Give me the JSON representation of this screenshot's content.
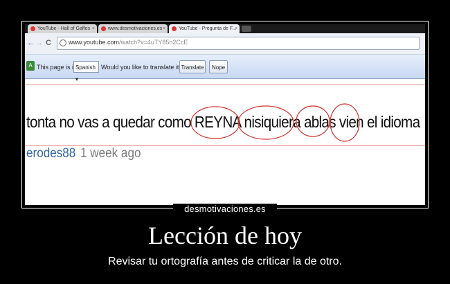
{
  "browser": {
    "tabs": [
      {
        "title": "YouTube - Hall of Gaffes",
        "active": false
      },
      {
        "title": "www.desmotivaciones.es",
        "active": false
      },
      {
        "title": "YouTube - Pregunta de F...",
        "active": true
      }
    ],
    "url_host": "www.youtube.com",
    "url_rest": "/watch?v=4uTY85n2CcE",
    "translate_bar": {
      "prefix": "This page is in",
      "language": "Spanish",
      "question": "Would you like to translate it?",
      "translate_label": "Translate",
      "nope_label": "Nope"
    }
  },
  "comment": {
    "text": "tonta no vas a quedar como REYNA nisiquiera ablas vien el  idioma",
    "author": "erodes88",
    "time": "1 week ago"
  },
  "poster": {
    "site": "desmotivaciones.es",
    "title": "Lección de hoy",
    "caption": "Revisar tu ortografía antes de criticar la de otro."
  },
  "colors": {
    "background": "#000000",
    "circle_marks": "#d0332f",
    "author_link": "#3566a6"
  }
}
